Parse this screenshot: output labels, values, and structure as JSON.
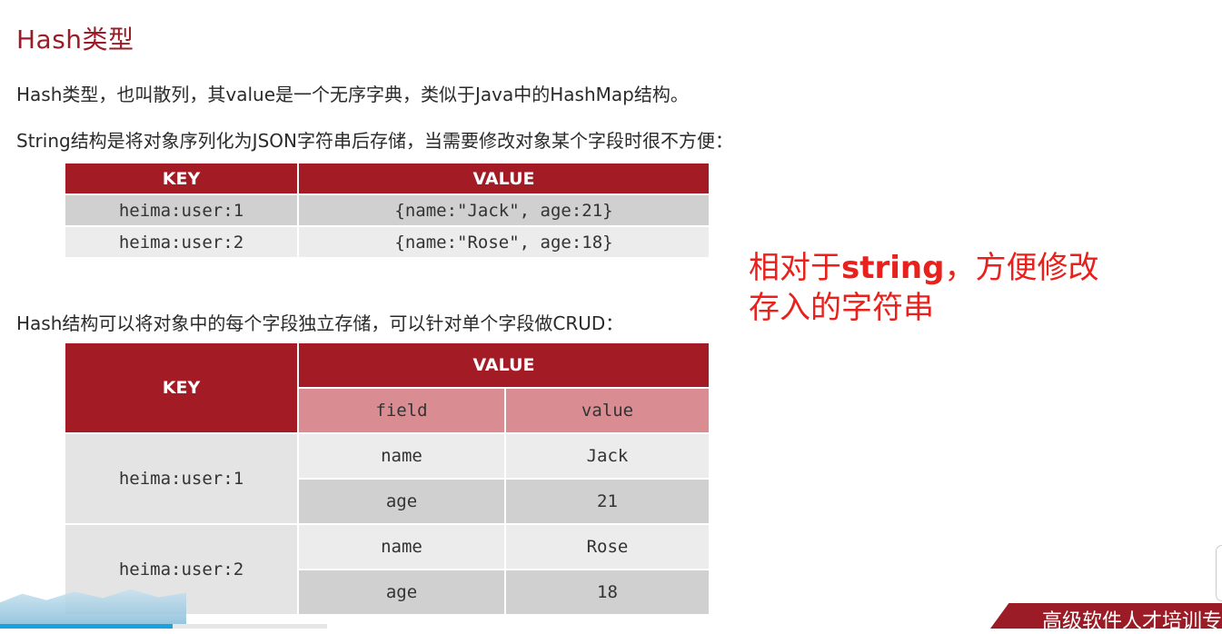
{
  "title": "Hash类型",
  "paragraphs": {
    "p1": "Hash类型，也叫散列，其value是一个无序字典，类似于Java中的HashMap结构。",
    "p2": "String结构是将对象序列化为JSON字符串后存储，当需要修改对象某个字段时很不方便：",
    "p3": "Hash结构可以将对象中的每个字段独立存储，可以针对单个字段做CRUD："
  },
  "string_table": {
    "headers": [
      "KEY",
      "VALUE"
    ],
    "rows": [
      [
        "heima:user:1",
        "{name:\"Jack\", age:21}"
      ],
      [
        "heima:user:2",
        "{name:\"Rose\", age:18}"
      ]
    ]
  },
  "hash_table": {
    "key_header": "KEY",
    "value_header": "VALUE",
    "sub_headers": [
      "field",
      "value"
    ],
    "groups": [
      {
        "key": "heima:user:1",
        "rows": [
          [
            "name",
            "Jack"
          ],
          [
            "age",
            "21"
          ]
        ]
      },
      {
        "key": "heima:user:2",
        "rows": [
          [
            "name",
            "Rose"
          ],
          [
            "age",
            "18"
          ]
        ]
      }
    ]
  },
  "annotation": {
    "prefix": "相对于",
    "bold": "string",
    "suffix": "，方便修改",
    "line2": "存入的字符串",
    "color": "#e8211c"
  },
  "footer": {
    "banner_text": "高级软件人才培训专"
  },
  "colors": {
    "accent": "#a31b25",
    "subheader": "#d98d93",
    "row_light": "#ececec",
    "row_dark": "#d0d0d0"
  }
}
